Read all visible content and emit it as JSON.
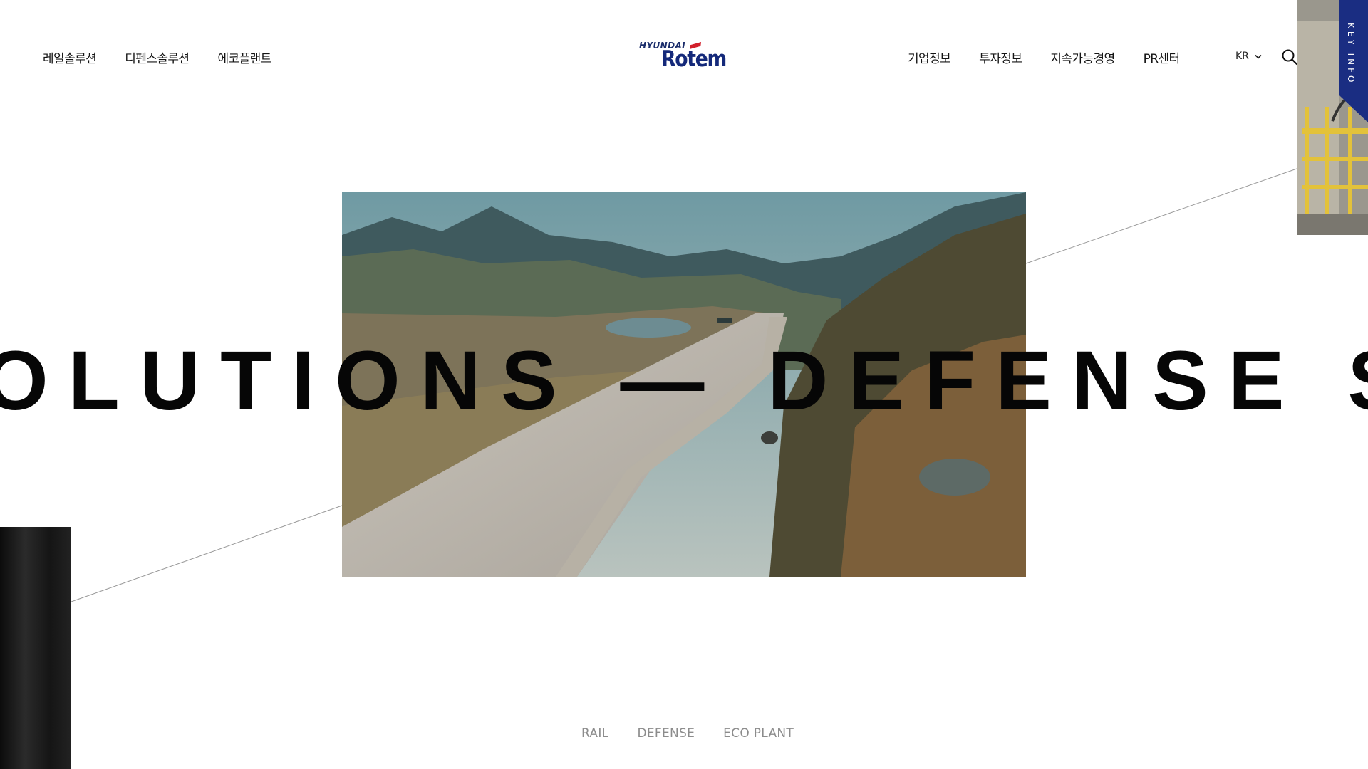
{
  "nav": {
    "left": [
      {
        "label": "레일솔루션"
      },
      {
        "label": "디펜스솔루션"
      },
      {
        "label": "에코플랜트"
      }
    ],
    "right": [
      {
        "label": "기업정보"
      },
      {
        "label": "투자정보"
      },
      {
        "label": "지속가능경영"
      },
      {
        "label": "PR센터"
      }
    ]
  },
  "logo": {
    "top": "HYUNDAI",
    "main": "Rotem",
    "icon": "hyundai-rotem-logo"
  },
  "lang": {
    "value": "KR",
    "icon": "chevron-down-icon"
  },
  "search": {
    "icon": "search-icon"
  },
  "key_info": {
    "label": "KEY INFO",
    "color": "#1a2d82"
  },
  "hero": {
    "marquee": "OLUTIONS — DEFENSE SOL"
  },
  "categories": [
    {
      "label": "RAIL"
    },
    {
      "label": "DEFENSE"
    },
    {
      "label": "ECO PLANT"
    }
  ],
  "colors": {
    "brand": "#14297a",
    "accent": "#d21f2b",
    "category_text": "#8c8c8c"
  }
}
